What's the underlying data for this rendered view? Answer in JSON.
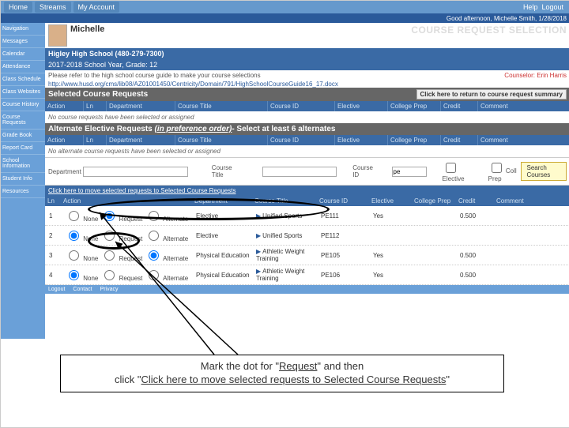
{
  "topnav": {
    "tabs": [
      "Home",
      "Streams",
      "My Account"
    ],
    "help": "Help",
    "logout": "Logout"
  },
  "greet": "Good afternoon, Michelle Smith, 1/28/2018",
  "sidebar": {
    "items": [
      "Navigation",
      "Messages",
      "Calendar",
      "Attendance",
      "Class Schedule",
      "Class Websites",
      "Course History",
      "Course Requests",
      "Grade Book",
      "Report Card",
      "School Information",
      "Student Info",
      "Resources"
    ]
  },
  "user": {
    "name": "Michelle",
    "title": "COURSE REQUEST SELECTION"
  },
  "school": "Higley High School (480-279-7300)",
  "year": "2017-2018 School Year, Grade: 12",
  "hint": "Please refer to the high school course guide to make your course selections",
  "counselor": {
    "label": "Counselor:",
    "name": "Erin Harris"
  },
  "url": "http://www.husd.org/cms/lib08/AZ01001450/Centricity/Domain/791/HighSchoolCourseGuide16_17.docx",
  "sect1": {
    "title": "Selected Course Requests",
    "ret": "Click here to return to course request summary",
    "cols": [
      "Action",
      "Ln",
      "Department",
      "Course Title",
      "Course ID",
      "Elective",
      "College Prep",
      "Credit",
      "Comment"
    ],
    "empty": "No course requests have been selected or assigned"
  },
  "sect2": {
    "title_a": "Alternate Elective Requests",
    "title_b": "(in preference order)",
    "title_c": " - Select at least 6 alternates",
    "cols": [
      "Action",
      "Ln",
      "Department",
      "Course Title",
      "Course ID",
      "Elective",
      "College Prep",
      "Credit",
      "Comment"
    ],
    "empty": "No alternate course requests have been selected or assigned"
  },
  "search": {
    "dept": "Department",
    "title": "Course Title",
    "cid": "Course ID",
    "cid_val": "pe",
    "elective": "Elective",
    "cprep": "Coll Prep",
    "btn": "Search Courses"
  },
  "move": {
    "link": "Click here to move selected requests to Selected Course Requests"
  },
  "rescols": [
    "Ln",
    "Action",
    "Department",
    "Course Title",
    "Course ID",
    "Elective",
    "College Prep",
    "Credit",
    "Comment"
  ],
  "radios": {
    "none": "None",
    "req": "Request",
    "alt": "Alternate"
  },
  "rows": [
    {
      "ln": "1",
      "sel": "request",
      "dept": "Elective",
      "title": "Unified Sports",
      "cid": "PE111",
      "elec": "Yes",
      "cprep": "",
      "cred": "0.500"
    },
    {
      "ln": "2",
      "sel": "none",
      "dept": "Elective",
      "title": "Unified Sports",
      "cid": "PE112",
      "elec": "",
      "cprep": "",
      "cred": ""
    },
    {
      "ln": "3",
      "sel": "alt",
      "dept": "Physical Education",
      "title": "Athletic Weight Training",
      "cid": "PE105",
      "elec": "Yes",
      "cprep": "",
      "cred": "0.500"
    },
    {
      "ln": "4",
      "sel": "none",
      "dept": "Physical Education",
      "title": "Athletic Weight Training",
      "cid": "PE106",
      "elec": "Yes",
      "cprep": "",
      "cred": "0.500"
    }
  ],
  "footer": [
    "Logout",
    "Contact",
    "Privacy"
  ],
  "callout": {
    "l1_a": "Mark the dot for \"",
    "l1_b": "Request",
    "l1_c": "\" and then",
    "l2_a": "click \"",
    "l2_b": "Click here to move selected requests to Selected Course Requests",
    "l2_c": "\""
  }
}
